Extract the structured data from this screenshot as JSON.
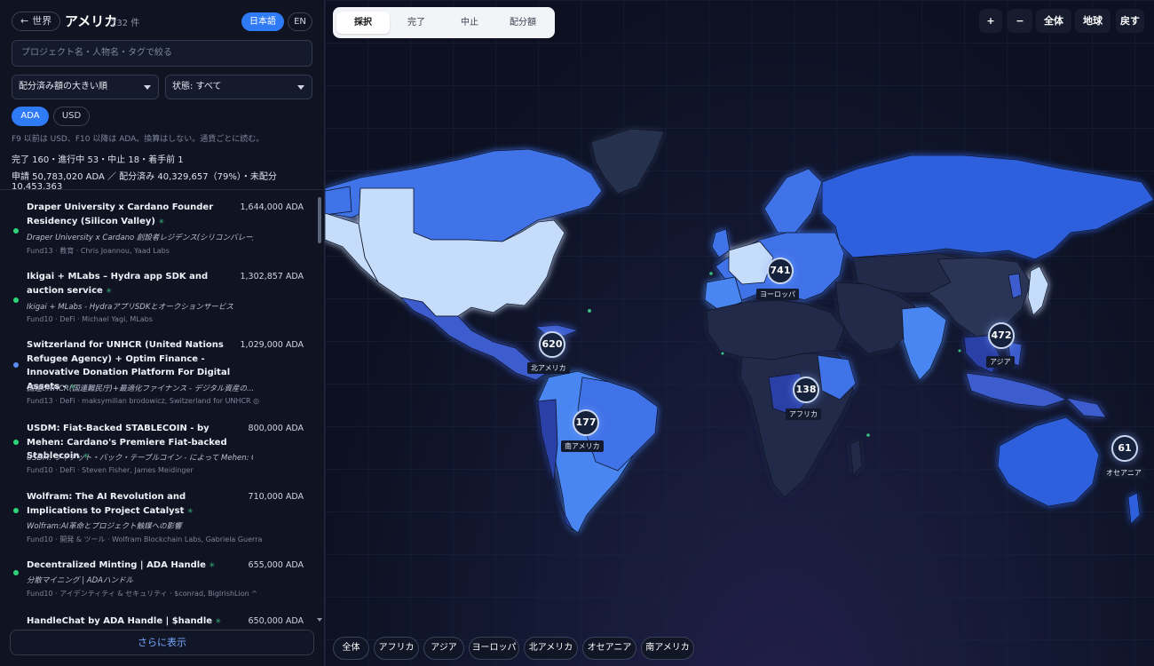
{
  "sidebar": {
    "back_label": "世界",
    "title": "アメリカ",
    "count": "232 件",
    "lang_ja": "日本語",
    "lang_en": "EN",
    "search_placeholder": "プロジェクト名・人物名・タグで絞る",
    "sort_label": "配分済み額の大きい順",
    "status_label": "状態: すべて",
    "currency_ada": "ADA",
    "currency_usd": "USD",
    "note": "F9 以前は USD、F10 以降は ADA。換算はしない。通貨ごとに読む。",
    "stats_line1": "完了 160・進行中 53・中止 18・着手前 1",
    "stats_line2": "申請 50,783,020 ADA ／ 配分済み 40,329,657（79%）・未配分 10,453,363",
    "more_label": "さらに表示",
    "items": [
      {
        "title": "Draper University x Cardano Founder Residency (Silicon Valley)",
        "amount": "1,644,000 ADA",
        "subtitle": "Draper University x Cardano 創設者レジデンス(シリコンバレー)",
        "meta": "Fund13 · 教育 · Chris Joannou, Yaad Labs",
        "status_color": "#2fd47a"
      },
      {
        "title": "Ikigai + MLabs – Hydra app SDK and auction service",
        "amount": "1,302,857 ADA",
        "subtitle": "Ikigai + MLabs - HydraアプリSDKとオークションサービス",
        "meta": "Fund10 · DeFi · Michael Yagi, MLabs",
        "status_color": "#2fd47a"
      },
      {
        "title": "Switzerland for UNHCR (United Nations Refugee Agency) + Optim Finance - Innovative Donation Platform For Digital Assets -",
        "amount": "1,029,000 ADA",
        "subtitle": "国連UNHCR(国連難民庁)+最適化ファイナンス - デジタル資産の...",
        "meta": "Fund13 · DeFi · maksymilian brodowicz, Switzerland for UNHCR ◎",
        "status_color": "#5b8df5"
      },
      {
        "title": "USDM: Fiat-Backed STABLECOIN - by Mehen: Cardano's Premiere Fiat-backed Stablecoin",
        "amount": "800,000 ADA",
        "subtitle": "USDM: フィアット・バック・テーブルコイン - によって Mehen: Cardanoの...",
        "meta": "Fund10 · DeFi · Steven Fisher, James Meidinger",
        "status_color": "#2fd47a"
      },
      {
        "title": "Wolfram: The AI Revolution and Implications to Project Catalyst",
        "amount": "710,000 ADA",
        "subtitle": "Wolfram:AI革命とプロジェクト触媒への影響",
        "meta": "Fund10 · 開発 & ツール · Wolfram Blockchain Labs, Gabriela Guerra",
        "status_color": "#2fd47a"
      },
      {
        "title": "Decentralized Minting | ADA Handle",
        "amount": "655,000 ADA",
        "subtitle": "分散マイニング | ADAハンドル",
        "meta": "Fund10 · アイデンティティ & セキュリティ · $conrad, BigIrishLion ^",
        "status_color": "#2fd47a"
      },
      {
        "title": "HandleChat by ADA Handle | $handle",
        "amount": "650,000 ADA",
        "subtitle": "",
        "meta": "",
        "status_color": "#2fd47a"
      }
    ]
  },
  "map": {
    "tabs": [
      "採択",
      "完了",
      "中止",
      "配分額"
    ],
    "active_tab": "採択",
    "controls": {
      "zoom_in": "+",
      "zoom_out": "−",
      "all": "全体",
      "globe": "地球",
      "back": "戻す"
    },
    "regions": [
      "全体",
      "アフリカ",
      "アジア",
      "ヨーロッパ",
      "北アメリカ",
      "オセアニア",
      "南アメリカ"
    ],
    "clusters": [
      {
        "count": "741",
        "label": "ヨーロッパ"
      },
      {
        "count": "620",
        "label": "北アメリカ"
      },
      {
        "count": "472",
        "label": "アジア"
      },
      {
        "count": "138",
        "label": "アフリカ"
      },
      {
        "count": "177",
        "label": "南アメリカ"
      },
      {
        "count": "61",
        "label": "オセアニア"
      }
    ]
  }
}
